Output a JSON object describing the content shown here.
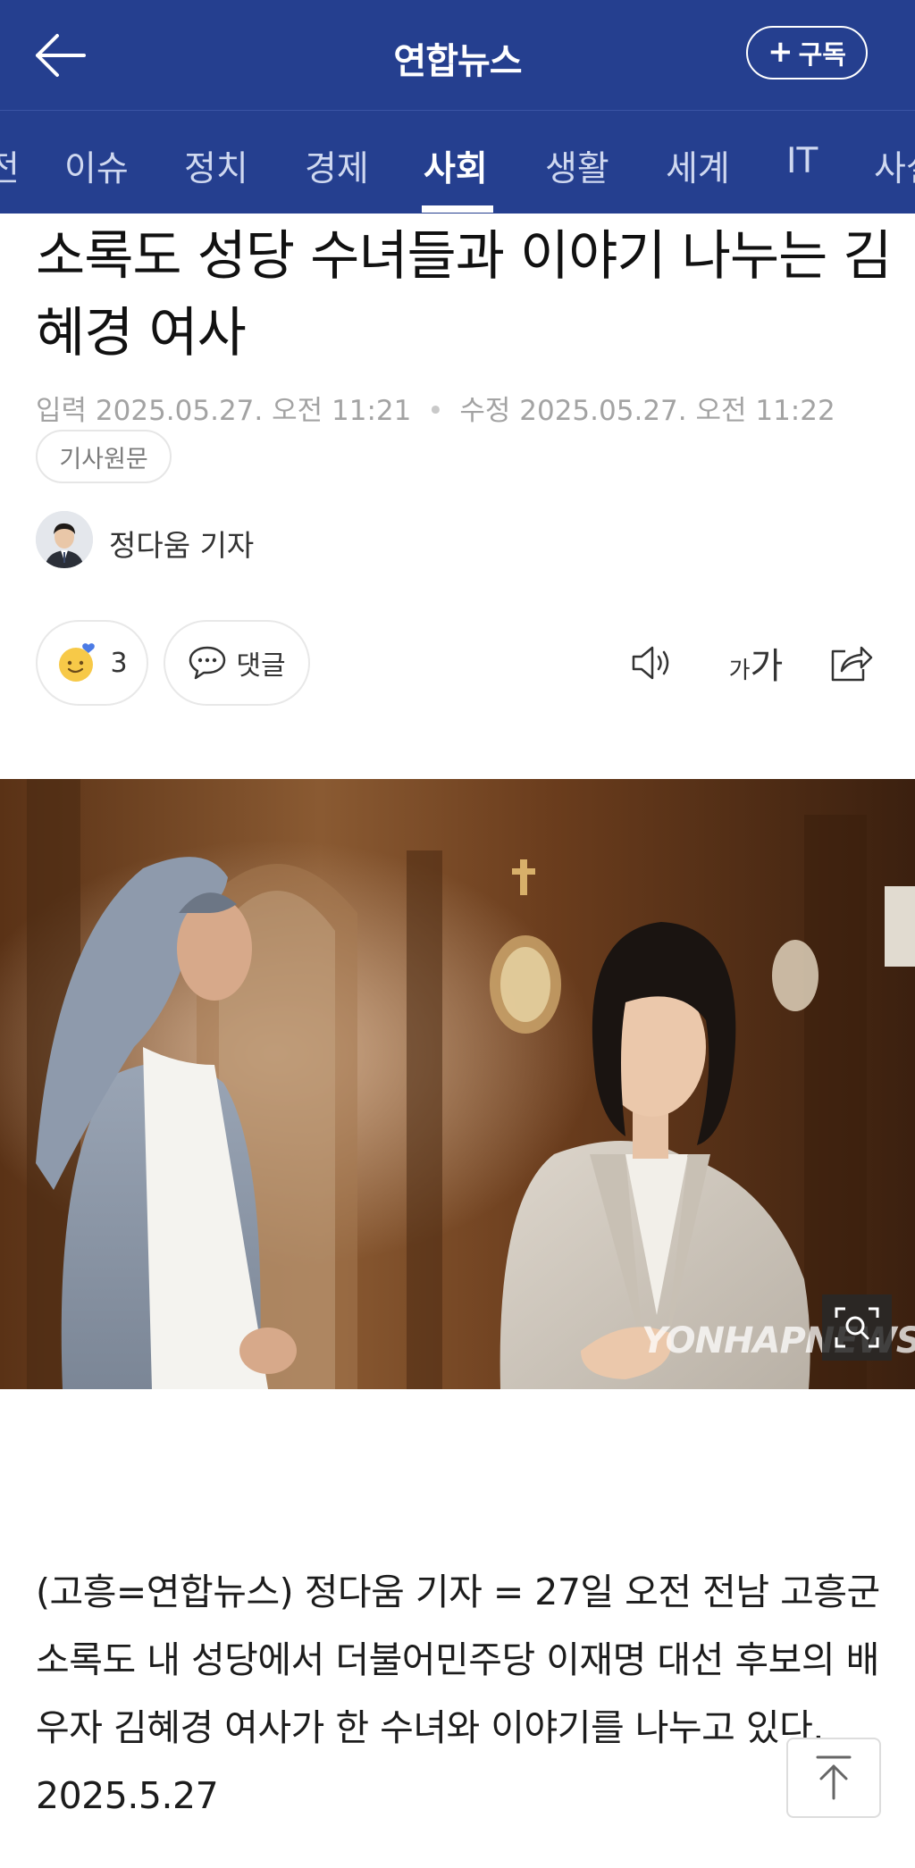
{
  "header": {
    "title": "연합뉴스",
    "subscribe_label": "구독",
    "back_icon": "arrow-left-icon"
  },
  "tabs": [
    {
      "label": "전",
      "active": false
    },
    {
      "label": "이슈",
      "active": false
    },
    {
      "label": "정치",
      "active": false
    },
    {
      "label": "경제",
      "active": false
    },
    {
      "label": "사회",
      "active": true
    },
    {
      "label": "생활",
      "active": false
    },
    {
      "label": "세계",
      "active": false
    },
    {
      "label": "IT",
      "active": false
    },
    {
      "label": "사설",
      "active": false
    }
  ],
  "article": {
    "headline": "소록도 성당 수녀들과 이야기 나누는 김혜경 여사",
    "input_label": "입력",
    "input_time": "2025.05.27. 오전 11:21",
    "edit_label": "수정",
    "edit_time": "2025.05.27. 오전 11:22",
    "original_label": "기사원문",
    "author": "정다움 기자",
    "reaction_count": "3",
    "comment_label": "댓글",
    "font_size_label_small": "가",
    "font_size_label_large": "가",
    "photo_watermark": "YONHAPNEWS",
    "caption": "(고흥=연합뉴스) 정다움 기자 = 27일 오전 전남 고흥군 소록도 내 성당에서 더불어민주당 이재명 대선 후보의 배우자 김혜경 여사가 한 수녀와 이야기를 나누고 있다. 2025.5.27"
  },
  "colors": {
    "header_bg": "#253f8f",
    "accent_white": "#ffffff",
    "meta_gray": "#a3a3a3"
  }
}
